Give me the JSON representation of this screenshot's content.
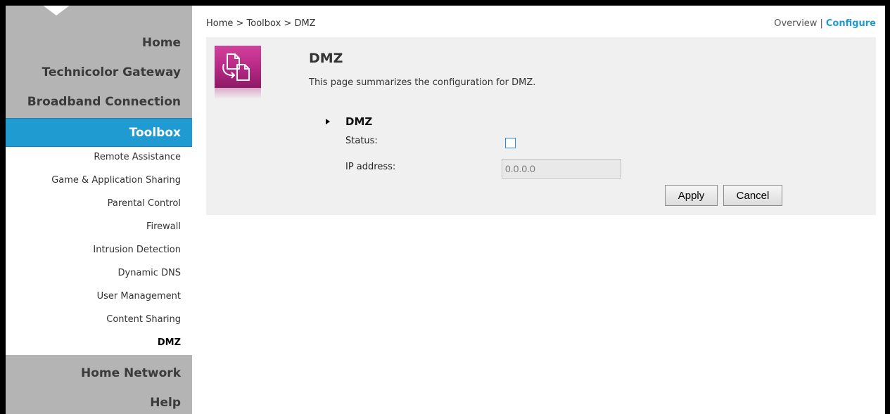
{
  "sidebar": {
    "main_items": [
      {
        "label": "Home"
      },
      {
        "label": "Technicolor Gateway"
      },
      {
        "label": "Broadband Connection"
      },
      {
        "label": "Toolbox"
      },
      {
        "label": "Home Network"
      },
      {
        "label": "Help"
      }
    ],
    "sub_items": [
      {
        "label": "Remote Assistance"
      },
      {
        "label": "Game & Application Sharing"
      },
      {
        "label": "Parental Control"
      },
      {
        "label": "Firewall"
      },
      {
        "label": "Intrusion Detection"
      },
      {
        "label": "Dynamic DNS"
      },
      {
        "label": "User Management"
      },
      {
        "label": "Content Sharing"
      },
      {
        "label": "DMZ"
      }
    ],
    "active_color": "#1f9bd2",
    "inactive_color": "#b4b4b4"
  },
  "header": {
    "breadcrumb": "Home > Toolbox > DMZ",
    "overview_label": "Overview",
    "separator": "|",
    "configure_label": "Configure"
  },
  "page": {
    "icon": "dmz-document-icon",
    "icon_color": "#b42783",
    "title": "DMZ",
    "description": "This page summarizes the configuration for DMZ."
  },
  "section": {
    "title": "DMZ",
    "status_label": "Status:",
    "status_checked": false,
    "ip_label": "IP address:",
    "ip_value": "0.0.0.0"
  },
  "buttons": {
    "apply_label": "Apply",
    "cancel_label": "Cancel"
  }
}
